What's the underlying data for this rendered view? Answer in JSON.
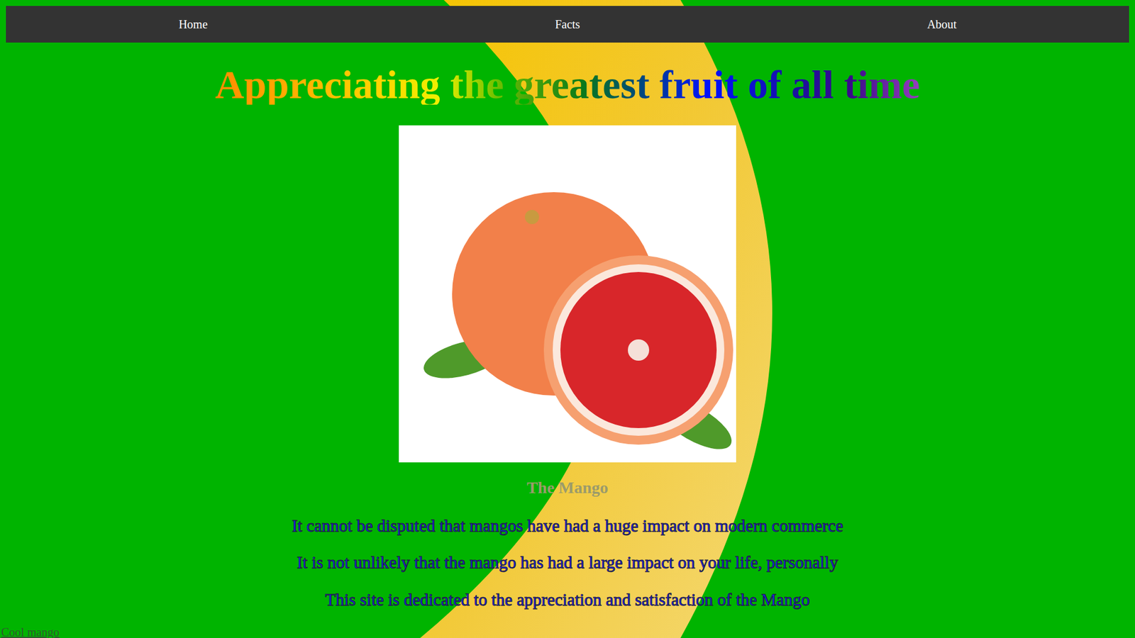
{
  "nav": {
    "items": [
      "Home",
      "Facts",
      "About"
    ]
  },
  "heading": "Appreciating the greatest fruit of all time",
  "caption": "The Mango",
  "paragraphs": [
    "It cannot be disputed that mangos have had a huge impact on modern commerce",
    "It is not unlikely that the mango has had a large impact on your life, personally",
    "This site is dedicated to the appreciation and satisfaction of the Mango"
  ],
  "footer_link": "Cool mango"
}
